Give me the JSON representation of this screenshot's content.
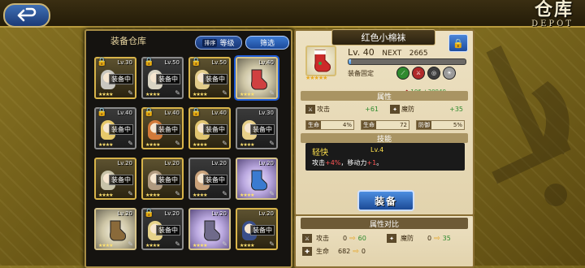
{
  "header": {
    "back_label": "返回",
    "title": "仓库",
    "title_en": "DEPOT"
  },
  "inventory": {
    "title": "装备仓库",
    "sort_prefix": "排序",
    "sort_label": "等级",
    "filter_label": "筛选",
    "equipped_tag": "装备中",
    "items": [
      {
        "lv": "Lv.30",
        "locked": true,
        "equipped": true,
        "kind": "portrait",
        "tint": "#c9c7c0"
      },
      {
        "lv": "Lv.50",
        "locked": true,
        "equipped": true,
        "kind": "portrait",
        "tint": "#d9d4c4"
      },
      {
        "lv": "Lv.50",
        "locked": true,
        "equipped": true,
        "kind": "portrait",
        "tint": "#e2cc8a"
      },
      {
        "lv": "Lv.40",
        "locked": false,
        "equipped": false,
        "kind": "gear",
        "tint": "#d04040",
        "selected": true,
        "rare": true
      },
      {
        "lv": "Lv.40",
        "locked": true,
        "equipped": true,
        "kind": "portrait",
        "tint": "#e6c86a"
      },
      {
        "lv": "Lv.40",
        "locked": true,
        "equipped": true,
        "kind": "portrait",
        "tint": "#d27a3a"
      },
      {
        "lv": "Lv.40",
        "locked": true,
        "equipped": true,
        "kind": "portrait",
        "tint": "#e0c470"
      },
      {
        "lv": "Lv.30",
        "locked": false,
        "equipped": true,
        "kind": "portrait",
        "tint": "#e8d08a"
      },
      {
        "lv": "Lv.20",
        "locked": false,
        "equipped": true,
        "kind": "portrait",
        "tint": "#c7c2a8"
      },
      {
        "lv": "Lv.20",
        "locked": false,
        "equipped": true,
        "kind": "portrait",
        "tint": "#b09a80"
      },
      {
        "lv": "Lv.20",
        "locked": false,
        "equipped": true,
        "kind": "portrait",
        "tint": "#c9a27a"
      },
      {
        "lv": "Lv.20",
        "locked": false,
        "equipped": false,
        "kind": "gear",
        "tint": "#3a7bd0",
        "rare": true,
        "violet": true
      },
      {
        "lv": "Lv.20",
        "locked": false,
        "equipped": false,
        "kind": "gear",
        "tint": "#8a6a3a",
        "rare": true
      },
      {
        "lv": "Lv.20",
        "locked": true,
        "equipped": true,
        "kind": "portrait",
        "tint": "#e6d28a"
      },
      {
        "lv": "Lv.20",
        "locked": false,
        "equipped": false,
        "kind": "gear",
        "tint": "#6f6a8a",
        "rare": true,
        "violet": true
      },
      {
        "lv": "Lv.20",
        "locked": false,
        "equipped": true,
        "kind": "portrait",
        "tint": "#3a4f8a"
      }
    ]
  },
  "detail": {
    "name": "红色小棉袜",
    "level": "Lv. 40",
    "next_label": "NEXT",
    "next_value": "2665",
    "exp_fraction": 0.02,
    "fixed_label": "装备固定",
    "cost_label": "106",
    "cost_value": "+30040",
    "attr_header": "属性",
    "attack_label": "攻击",
    "attack_value": "+61",
    "mdef_label": "魔防",
    "mdef_value": "+35",
    "hp_label": "生命",
    "hp_pct": "4%",
    "hp2_label": "生命",
    "hp2_value": "72",
    "def_label": "防御",
    "def_pct": "5%",
    "skill_header": "技能",
    "skill_name": "轻快",
    "skill_lv": "Lv.4",
    "skill_desc_a": "攻击",
    "skill_desc_a_val": "+4%",
    "skill_desc_b": "，移动力",
    "skill_desc_b_val": "+1",
    "skill_desc_end": "。",
    "equip_button": "装备"
  },
  "compare": {
    "header": "属性对比",
    "attack_label": "攻击",
    "attack_old": "0",
    "attack_new": "60",
    "mdef_label": "魔防",
    "mdef_old": "0",
    "mdef_new": "35",
    "hp_label": "生命",
    "hp_old": "682",
    "hp_new": "0"
  },
  "colors": {
    "accent_blue": "#1f5bd6",
    "gold_border": "#a88d45",
    "plus_green": "#2e8a2e"
  }
}
